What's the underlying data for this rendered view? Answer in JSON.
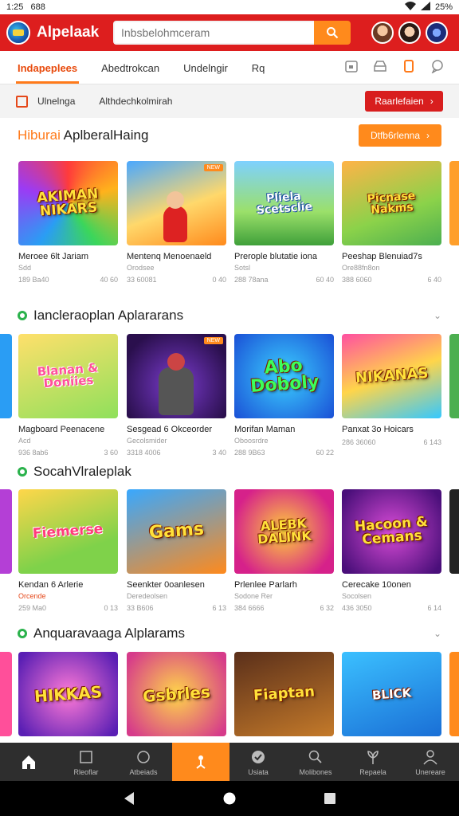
{
  "status_bar": {
    "time": "1:25",
    "carrier": "688",
    "battery": "25%"
  },
  "header": {
    "title": "Alpelaak",
    "search_placeholder": "Inbsbelohmceram",
    "colors": {
      "brand": "#dd1e1e",
      "accent": "#ff8a1c"
    }
  },
  "tabs": [
    {
      "label": "Indapeplees",
      "active": true
    },
    {
      "label": "Abedtrokcan"
    },
    {
      "label": "Undelngir"
    },
    {
      "label": "Rq"
    }
  ],
  "filter": {
    "label": "Ulnelnga",
    "value": "Althdechkolmirah",
    "button": "Raarlefaien"
  },
  "sections": [
    {
      "title_highlight": "Hiburai",
      "title_rest": " AplberalHaing",
      "more_label": "Dtfb6rlenna",
      "cards": [
        {
          "thumb_text": "AKIMAN NIKARS",
          "name": "Meroee 6lt Jariam",
          "dev": "Sdd",
          "stat1": "189 Ba40",
          "stat2": "40 60"
        },
        {
          "thumb_text": "",
          "badge": "NEW",
          "name": "Mentenq Menoenaeld",
          "dev": "Orodsee",
          "stat1": "33 60081",
          "stat2": "0 40"
        },
        {
          "thumb_text": "Pliela Scetsclie",
          "name": "Prerople blutatie iona",
          "dev": "Sotsl",
          "stat1": "288 78ana",
          "stat2": "60 40"
        },
        {
          "thumb_text": "Picnase Nakms",
          "name": "Peeshap Blenuiad7s",
          "dev": "Ore88fn8on",
          "stat1": "388 6060",
          "stat2": "6 40"
        }
      ]
    },
    {
      "title_highlight": "",
      "title_rest": "Iancleraoplan Aplararans",
      "cards": [
        {
          "thumb_text": "Blanan & Doniies",
          "name": "Magboard Peenacene",
          "dev": "Acd",
          "stat1": "936 8ab6",
          "stat2": "3 60"
        },
        {
          "thumb_text": "",
          "badge": "NEW",
          "name": "Sesgead 6 Okceorder",
          "dev": "Gecolsmider",
          "stat1": "3318 4006",
          "stat2": "3 40"
        },
        {
          "thumb_text": "Abo Doboly",
          "name": "Morifan Maman",
          "dev": "Oboosrdre",
          "stat1": "288 9B63",
          "stat2": "60 22"
        },
        {
          "thumb_text": "NIKANAS",
          "name": "Panxat 3o Hoicars",
          "dev": "",
          "stat1": "286 36060",
          "stat2": "6 143"
        }
      ]
    },
    {
      "title_highlight": "",
      "title_rest": "SocahVlraleplak",
      "cards": [
        {
          "thumb_text": "Fiemerse",
          "name": "Kendan 6 Arlerie",
          "dev": "Orcende",
          "stat1": "259 Ma0",
          "stat2": "0 13"
        },
        {
          "thumb_text": "Gams",
          "name": "Seenkter 0oanlesen",
          "dev": "Deredeolsen",
          "stat1": "33 B606",
          "stat2": "6 13"
        },
        {
          "thumb_text": "ALEBK DALINK",
          "name": "Prlenlee Parlarh",
          "dev": "Sodone Rer",
          "stat1": "384 6666",
          "stat2": "6 32"
        },
        {
          "thumb_text": "Hacoon & Cemans",
          "name": "Cerecake 10onen",
          "dev": "Socolsen",
          "stat1": "436 3050",
          "stat2": "6 14"
        }
      ]
    },
    {
      "title_highlight": "",
      "title_rest": "Anquaravaaga Alplarams",
      "cards": [
        {
          "thumb_text": "HIKKAS"
        },
        {
          "thumb_text": "Gsbrles"
        },
        {
          "thumb_text": "Fiaptan"
        },
        {
          "thumb_text": "BLICK"
        }
      ]
    }
  ],
  "bottom_nav": [
    {
      "label": "",
      "icon": "home-icon"
    },
    {
      "label": "Rleoflar",
      "icon": "square-icon"
    },
    {
      "label": "Atbeiads",
      "icon": "circle-icon"
    },
    {
      "label": "",
      "icon": "person-icon",
      "active": true
    },
    {
      "label": "Usiata",
      "icon": "check-icon"
    },
    {
      "label": "Molibones",
      "icon": "search-icon"
    },
    {
      "label": "Repaela",
      "icon": "plant-icon"
    },
    {
      "label": "Unereare",
      "icon": "user-icon"
    }
  ]
}
